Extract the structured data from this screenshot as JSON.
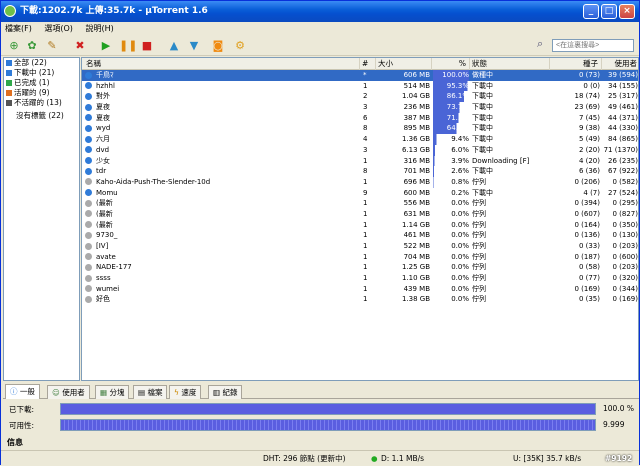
{
  "window": {
    "title": "下載:1202.7k 上傳:35.7k - µTorrent 1.6"
  },
  "menu": [
    "檔案(F)",
    "選項(O)",
    "說明(H)"
  ],
  "search": {
    "placeholder": "<在這裏搜尋>"
  },
  "sidebar": {
    "items": [
      {
        "label": "全部 (22)",
        "color": "#2f7bd8"
      },
      {
        "label": "下載中 (21)",
        "color": "#2f7bd8"
      },
      {
        "label": "已完成 (1)",
        "color": "#2fa84a"
      },
      {
        "label": "活躍的 (9)",
        "color": "#e07020"
      },
      {
        "label": "不活躍的 (13)",
        "color": "#555555"
      }
    ],
    "nolabel": "沒有標籤 (22)"
  },
  "columns": {
    "name": "名稱",
    "num": "#",
    "size": "大小",
    "pct": "%",
    "status": "狀態",
    "seeds": "種子",
    "peers": "使用者"
  },
  "torrents": [
    {
      "name": "千鳥ﾏ",
      "num": "*",
      "size": "606 MB",
      "pct": "100.0%",
      "progress": 1.0,
      "status": "做種中",
      "seeds": "0 (73)",
      "peers": "39 (594)",
      "selected": true
    },
    {
      "name": "hzhhl",
      "num": "1",
      "size": "514 MB",
      "pct": "95.3%",
      "progress": 0.953,
      "status": "下載中",
      "seeds": "0 (0)",
      "peers": "34 (155)"
    },
    {
      "name": "對外",
      "num": "2",
      "size": "1.04 GB",
      "pct": "86.1%",
      "progress": 0.861,
      "status": "下載中",
      "seeds": "18 (74)",
      "peers": "25 (317)"
    },
    {
      "name": "夏夜",
      "num": "3",
      "size": "236 MB",
      "pct": "73.7%",
      "progress": 0.737,
      "status": "下載中",
      "seeds": "23 (69)",
      "peers": "49 (461)"
    },
    {
      "name": "夏夜",
      "num": "6",
      "size": "387 MB",
      "pct": "71.5%",
      "progress": 0.715,
      "status": "下載中",
      "seeds": "7 (45)",
      "peers": "44 (371)"
    },
    {
      "name": "wyd",
      "num": "8",
      "size": "895 MB",
      "pct": "64.7%",
      "progress": 0.647,
      "status": "下載中",
      "seeds": "9 (38)",
      "peers": "44 (330)"
    },
    {
      "name": "六月",
      "num": "4",
      "size": "1.36 GB",
      "pct": "9.4%",
      "progress": 0.094,
      "status": "下載中",
      "seeds": "5 (49)",
      "peers": "84 (865)"
    },
    {
      "name": "dvd",
      "num": "3",
      "size": "6.13 GB",
      "pct": "6.0%",
      "progress": 0.06,
      "status": "下載中",
      "seeds": "2 (20)",
      "peers": "71 (1370)"
    },
    {
      "name": "少女",
      "num": "1",
      "size": "316 MB",
      "pct": "3.9%",
      "progress": 0.039,
      "status": "Downloading [F]",
      "seeds": "4 (20)",
      "peers": "26 (235)"
    },
    {
      "name": "tdr",
      "num": "8",
      "size": "701 MB",
      "pct": "2.6%",
      "progress": 0.026,
      "status": "下載中",
      "seeds": "6 (36)",
      "peers": "67 (922)"
    },
    {
      "name": "Kaho-Aida-Push-The-Slender-10d",
      "num": "1",
      "size": "696 MB",
      "pct": "0.8%",
      "progress": 0.008,
      "status": "佇列",
      "seeds": "0 (206)",
      "peers": "0 (582)"
    },
    {
      "name": "Momu",
      "num": "9",
      "size": "600 MB",
      "pct": "0.2%",
      "progress": 0.002,
      "status": "下載中",
      "seeds": "4 (7)",
      "peers": "27 (524)"
    },
    {
      "name": "(最新",
      "num": "1",
      "size": "556 MB",
      "pct": "0.0%",
      "progress": 0,
      "status": "佇列",
      "seeds": "0 (394)",
      "peers": "0 (295)"
    },
    {
      "name": "(最新",
      "num": "1",
      "size": "631 MB",
      "pct": "0.0%",
      "progress": 0,
      "status": "佇列",
      "seeds": "0 (607)",
      "peers": "0 (827)"
    },
    {
      "name": "(最新",
      "num": "1",
      "size": "1.14 GB",
      "pct": "0.0%",
      "progress": 0,
      "status": "佇列",
      "seeds": "0 (164)",
      "peers": "0 (350)"
    },
    {
      "name": "9730_",
      "num": "1",
      "size": "461 MB",
      "pct": "0.0%",
      "progress": 0,
      "status": "佇列",
      "seeds": "0 (136)",
      "peers": "0 (130)"
    },
    {
      "name": "[IV]",
      "num": "1",
      "size": "522 MB",
      "pct": "0.0%",
      "progress": 0,
      "status": "佇列",
      "seeds": "0 (33)",
      "peers": "0 (203)"
    },
    {
      "name": "avate",
      "num": "1",
      "size": "704 MB",
      "pct": "0.0%",
      "progress": 0,
      "status": "佇列",
      "seeds": "0 (187)",
      "peers": "0 (600)"
    },
    {
      "name": "NADE-177",
      "num": "1",
      "size": "1.25 GB",
      "pct": "0.0%",
      "progress": 0,
      "status": "佇列",
      "seeds": "0 (58)",
      "peers": "0 (203)"
    },
    {
      "name": "ssss",
      "num": "1",
      "size": "1.10 GB",
      "pct": "0.0%",
      "progress": 0,
      "status": "佇列",
      "seeds": "0 (77)",
      "peers": "0 (320)"
    },
    {
      "name": "wumei",
      "num": "1",
      "size": "439 MB",
      "pct": "0.0%",
      "progress": 0,
      "status": "佇列",
      "seeds": "0 (169)",
      "peers": "0 (344)"
    },
    {
      "name": "好色",
      "num": "1",
      "size": "1.38 GB",
      "pct": "0.0%",
      "progress": 0,
      "status": "佇列",
      "seeds": "0 (35)",
      "peers": "0 (169)"
    }
  ],
  "tabs": [
    "一般",
    "使用者",
    "分塊",
    "檔案",
    "速度",
    "紀錄"
  ],
  "details": {
    "downloaded_label": "已下載:",
    "downloaded_value": "100.0 %",
    "availability_label": "可用性:",
    "availability_value": "9.999",
    "info_header": "信息"
  },
  "statusbar": {
    "dht": "DHT: 296 節點 (更新中)",
    "download": "D: 1.1 MB/s",
    "upload": "U: [35K] 35.7 kB/s"
  },
  "watermark": "#9192"
}
